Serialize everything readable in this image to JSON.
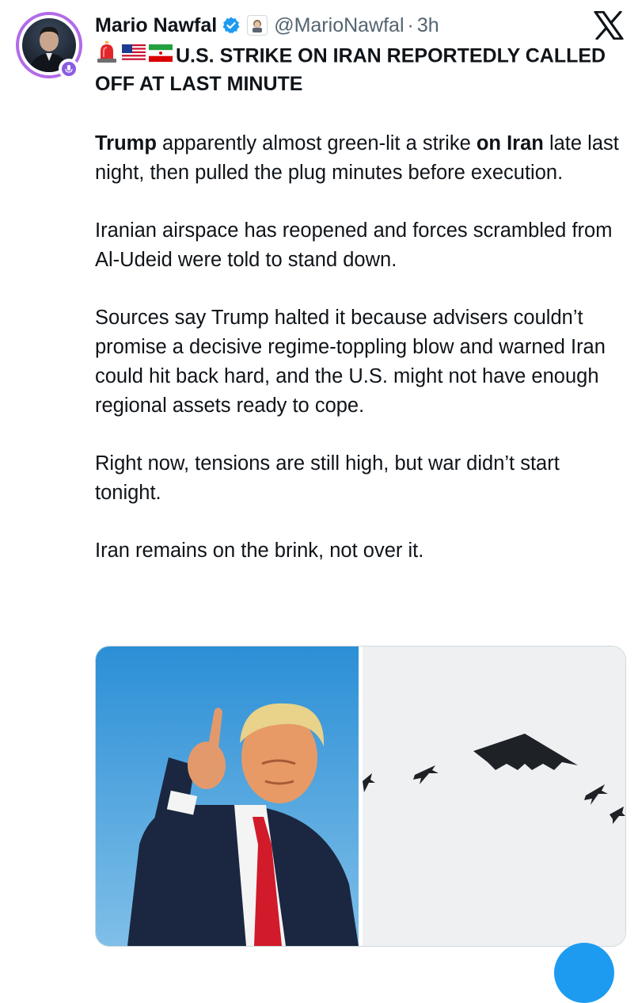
{
  "author": {
    "name": "Mario Nawfal",
    "handle": "@MarioNawfal",
    "separator": "·",
    "time": "3h"
  },
  "post": {
    "title_emojis": [
      "rotating-light",
      "us-flag",
      "iran-flag"
    ],
    "title": "U.S. STRIKE ON IRAN REPORTEDLY CALLED OFF AT LAST MINUTE",
    "p1_strong_a": "Trump",
    "p1_mid": " apparently almost green-lit a strike ",
    "p1_strong_b": "on Iran",
    "p1_rest": " late last night, then pulled the plug minutes before execution.",
    "p2": "Iranian airspace has reopened and forces scrambled from Al-Udeid were told to stand down.",
    "p3": "Sources say Trump halted it because advisers couldn’t promise a decisive regime-toppling blow and warned Iran could hit back hard, and the U.S. might not have enough regional assets ready to cope.",
    "p4": "Right now, tensions are still high, but war didn’t start tonight.",
    "p5": "Iran remains on the brink, not over it."
  },
  "colors": {
    "verified": "#1d9bf0",
    "avatar_ring": "#b26be8",
    "text": "#0f1419",
    "secondary": "#536471"
  }
}
